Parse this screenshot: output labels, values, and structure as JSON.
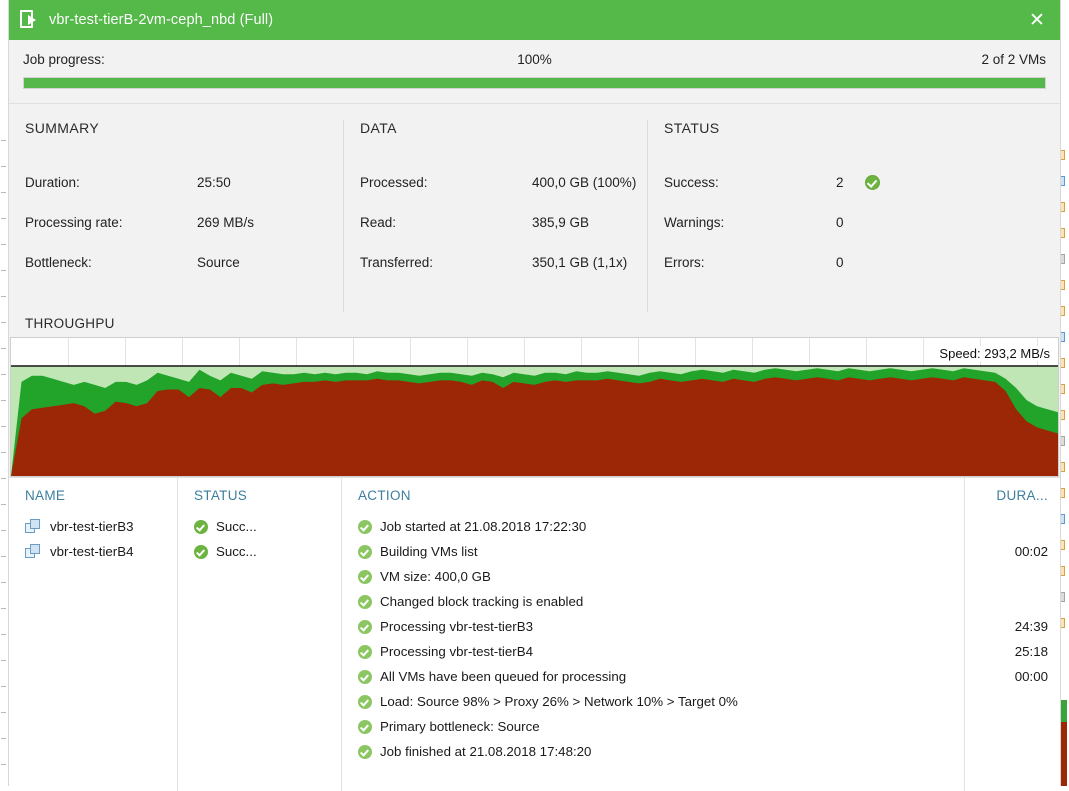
{
  "window": {
    "title": "vbr-test-tierB-2vm-ceph_nbd (Full)",
    "close_label": "✕",
    "title_icon": "job-page-icon",
    "accent_color": "#54b948"
  },
  "progress": {
    "label": "Job progress:",
    "percent_text": "100%",
    "percent_value": 100,
    "vms_text": "2 of 2 VMs"
  },
  "summary": {
    "heading": "SUMMARY",
    "rows": [
      {
        "label": "Duration:",
        "value": "25:50"
      },
      {
        "label": "Processing rate:",
        "value": "269 MB/s"
      },
      {
        "label": "Bottleneck:",
        "value": "Source"
      }
    ]
  },
  "data_section": {
    "heading": "DATA",
    "rows": [
      {
        "label": "Processed:",
        "value": "400,0 GB (100%)"
      },
      {
        "label": "Read:",
        "value": "385,9 GB"
      },
      {
        "label": "Transferred:",
        "value": "350,1 GB (1,1x)"
      }
    ]
  },
  "status_section": {
    "heading": "STATUS",
    "rows": [
      {
        "label": "Success:",
        "value": "2",
        "has_check": true
      },
      {
        "label": "Warnings:",
        "value": "0",
        "has_check": false
      },
      {
        "label": "Errors:",
        "value": "0",
        "has_check": false
      }
    ]
  },
  "throughput": {
    "heading": "THROUGHPU",
    "speed_label": "Speed: 293,2 MB/s"
  },
  "chart_data": {
    "type": "area",
    "title": "THROUGHPU",
    "annotations": [
      "Speed: 293,2 MB/s"
    ],
    "xlabel": "",
    "ylabel": "",
    "grid": true,
    "legend_position": "none",
    "ylim": [
      0,
      100
    ],
    "series": [
      {
        "name": "processing-rate",
        "color": "#9c2706",
        "values": [
          0,
          38,
          44,
          45,
          46,
          47,
          48,
          46,
          41,
          43,
          49,
          48,
          46,
          48,
          56,
          57,
          57,
          52,
          58,
          57,
          52,
          58,
          58,
          55,
          60,
          61,
          60,
          61,
          62,
          62,
          63,
          62,
          63,
          63,
          63,
          64,
          63,
          63,
          62,
          61,
          62,
          63,
          63,
          62,
          60,
          63,
          62,
          58,
          62,
          61,
          60,
          62,
          63,
          62,
          63,
          63,
          63,
          64,
          63,
          62,
          61,
          62,
          64,
          63,
          62,
          63,
          64,
          63,
          62,
          64,
          63,
          62,
          64,
          65,
          64,
          63,
          64,
          65,
          64,
          63,
          65,
          64,
          63,
          64,
          65,
          64,
          63,
          64,
          65,
          64,
          63,
          65,
          64,
          63,
          62,
          56,
          44,
          36,
          32,
          30,
          28
        ]
      },
      {
        "name": "read-rate",
        "color": "#22a32a",
        "values": [
          0,
          62,
          66,
          66,
          64,
          62,
          60,
          62,
          60,
          58,
          62,
          62,
          60,
          63,
          68,
          66,
          64,
          62,
          70,
          66,
          63,
          68,
          66,
          64,
          69,
          68,
          67,
          67,
          68,
          67,
          68,
          67,
          68,
          68,
          67,
          69,
          68,
          68,
          67,
          66,
          67,
          68,
          68,
          67,
          66,
          68,
          67,
          65,
          68,
          67,
          66,
          68,
          68,
          67,
          69,
          68,
          68,
          69,
          68,
          67,
          66,
          68,
          69,
          68,
          67,
          69,
          70,
          69,
          68,
          70,
          69,
          68,
          70,
          71,
          70,
          69,
          70,
          71,
          70,
          69,
          71,
          70,
          69,
          70,
          71,
          70,
          69,
          70,
          71,
          70,
          69,
          71,
          70,
          69,
          68,
          64,
          58,
          50,
          46,
          44,
          42
        ]
      },
      {
        "name": "peak-envelope",
        "color": "#bfe6b4",
        "values": [
          72,
          72,
          72,
          72,
          72,
          72,
          72,
          72,
          72,
          72,
          72,
          72,
          72,
          72,
          72,
          72,
          72,
          72,
          72,
          72,
          72,
          72,
          72,
          72,
          72,
          72,
          72,
          72,
          72,
          72,
          72,
          72,
          72,
          72,
          72,
          72,
          72,
          72,
          72,
          72,
          72,
          72,
          72,
          72,
          72,
          72,
          72,
          72,
          72,
          72,
          72,
          72,
          72,
          72,
          72,
          72,
          72,
          72,
          72,
          72,
          72,
          72,
          72,
          72,
          72,
          72,
          72,
          72,
          72,
          72,
          72,
          72,
          72,
          72,
          72,
          72,
          72,
          72,
          72,
          72,
          72,
          72,
          72,
          72,
          72,
          72,
          72,
          72,
          72,
          72,
          72,
          72,
          72,
          72,
          72,
          72,
          72,
          72,
          72,
          72,
          72
        ]
      }
    ]
  },
  "table": {
    "headers": {
      "name": "NAME",
      "status": "STATUS",
      "action": "ACTION",
      "duration": "DURA..."
    },
    "vms": [
      {
        "name": "vbr-test-tierB3",
        "status": "Succ..."
      },
      {
        "name": "vbr-test-tierB4",
        "status": "Succ..."
      }
    ],
    "actions": [
      {
        "text": "Job started at 21.08.2018 17:22:30",
        "duration": ""
      },
      {
        "text": "Building VMs list",
        "duration": "00:02"
      },
      {
        "text": "VM size: 400,0 GB",
        "duration": ""
      },
      {
        "text": "Changed block tracking is enabled",
        "duration": ""
      },
      {
        "text": "Processing vbr-test-tierB3",
        "duration": "24:39"
      },
      {
        "text": "Processing vbr-test-tierB4",
        "duration": "25:18"
      },
      {
        "text": "All VMs have been queued for processing",
        "duration": "00:00"
      },
      {
        "text": "Load: Source 98% > Proxy 26% > Network 10% > Target 0%",
        "duration": ""
      },
      {
        "text": "Primary bottleneck: Source",
        "duration": ""
      },
      {
        "text": "Job finished at 21.08.2018 17:48:20",
        "duration": ""
      }
    ]
  }
}
